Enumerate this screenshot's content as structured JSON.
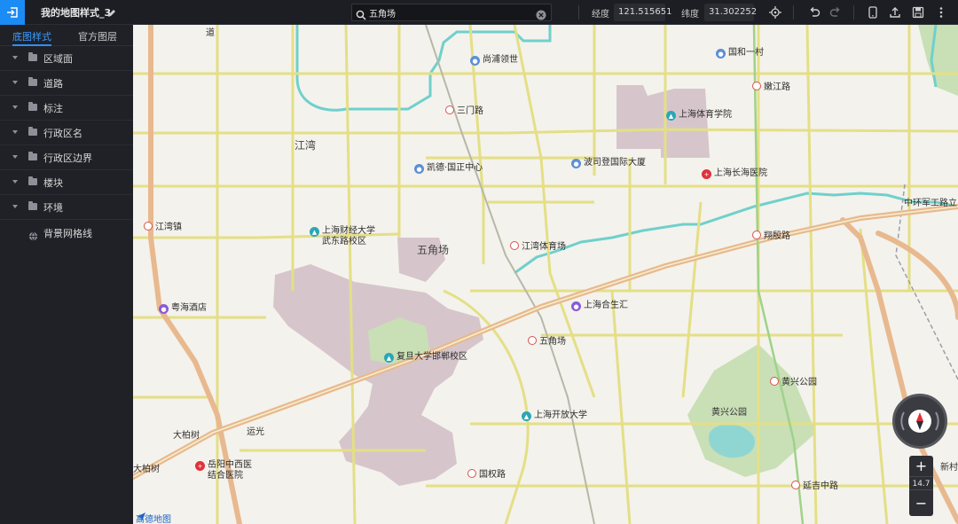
{
  "header": {
    "doc_title": "我的地图样式_3",
    "search_value": "五角场",
    "lng_label": "经度",
    "lng_value": "121.515651",
    "lat_label": "纬度",
    "lat_value": "31.302252"
  },
  "sidebar": {
    "tabs": [
      "底图样式",
      "官方图层"
    ],
    "layers": [
      "区域面",
      "道路",
      "标注",
      "行政区名",
      "行政区边界",
      "楼块",
      "环境"
    ],
    "grid_label": "背景网格线"
  },
  "map": {
    "zoom": "14.7",
    "logo": "高德地图",
    "labels": {
      "jiangwan": "江湾",
      "wujiaochang": "五角场",
      "dabaishu": "大柏树",
      "yunguang": "运光",
      "baishu_left": "大柏树",
      "huangxing_park": "黄兴公园",
      "zhonghuan": "中环军工路立",
      "xincun": "新村",
      "road_d": "道"
    },
    "pois": [
      {
        "name": "尚浦领世",
        "type": "blue"
      },
      {
        "name": "国和一村",
        "type": "blue"
      },
      {
        "name": "上海体育学院",
        "type": "teal"
      },
      {
        "name": "凯德·国正中心",
        "type": "blue"
      },
      {
        "name": "波司登国际大厦",
        "type": "blue"
      },
      {
        "name": "上海长海医院",
        "type": "red"
      },
      {
        "name": "上海财经大学\n武东路校区",
        "type": "teal"
      },
      {
        "name": "粤海酒店",
        "type": "purple"
      },
      {
        "name": "上海合生汇",
        "type": "purple"
      },
      {
        "name": "复旦大学邯郸校区",
        "type": "teal"
      },
      {
        "name": "上海开放大学",
        "type": "teal"
      },
      {
        "name": "岳阳中西医\n结合医院",
        "type": "red"
      }
    ],
    "metro": [
      "三门路",
      "嫩江路",
      "江湾镇",
      "江湾体育场",
      "翔殷路",
      "五角场",
      "黄兴公园",
      "国权路",
      "延吉中路"
    ]
  },
  "colors": {
    "accent": "#1b8bf5",
    "road_main": "#e8b98f",
    "road_minor": "#e5e27a",
    "water": "#6fd0cc",
    "campus": "#d9c5cc",
    "park": "#c9dfb6"
  }
}
